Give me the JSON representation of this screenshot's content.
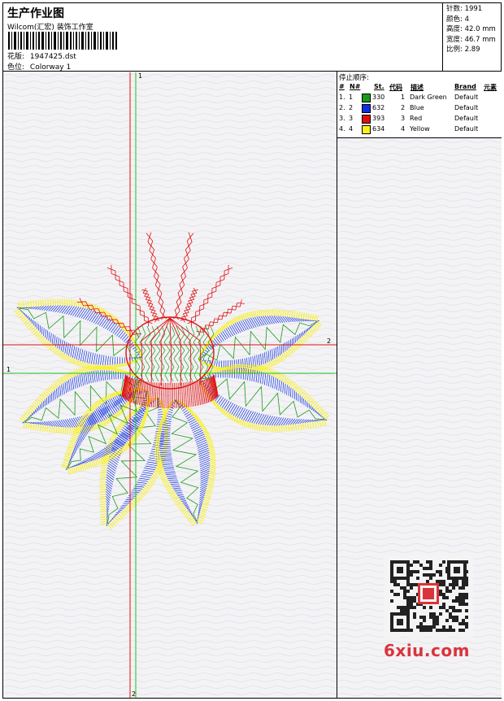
{
  "header": {
    "title": "生产作业图",
    "company": "Wilcom(汇宏) 装饰工作室",
    "design_label": "花版:",
    "design_value": "1947425.dst",
    "colorway_label": "色位:",
    "colorway_value": "Colorway 1"
  },
  "stats": [
    {
      "label": "针数:",
      "value": "1991"
    },
    {
      "label": "颜色:",
      "value": "4"
    },
    {
      "label": "高度:",
      "value": "42.0 mm"
    },
    {
      "label": "宽度:",
      "value": "46.7 mm"
    },
    {
      "label": "比例:",
      "value": "2.89"
    }
  ],
  "stop_sequence": {
    "title": "停止顺序:",
    "headers": {
      "num": "#",
      "no": "N#",
      "st": "St.",
      "code": "代码",
      "desc": "描述",
      "brand": "Brand",
      "elements": "元素"
    },
    "rows": [
      {
        "num": "1.",
        "no": "1",
        "color": "#1a9a1a",
        "st": "330",
        "code": "1",
        "desc": "Dark Green",
        "brand": "Default"
      },
      {
        "num": "2.",
        "no": "2",
        "color": "#1030e0",
        "st": "632",
        "code": "2",
        "desc": "Blue",
        "brand": "Default"
      },
      {
        "num": "3.",
        "no": "3",
        "color": "#e01010",
        "st": "393",
        "code": "3",
        "desc": "Red",
        "brand": "Default"
      },
      {
        "num": "4.",
        "no": "4",
        "color": "#f8f020",
        "st": "634",
        "code": "4",
        "desc": "Yellow",
        "brand": "Default"
      }
    ]
  },
  "axes": {
    "v1": "1",
    "v2": "2",
    "h1": "1",
    "h2": "2"
  },
  "watermark": "6xiu.com",
  "colors": {
    "green": "#1a9a1a",
    "blue": "#1030e0",
    "red": "#e01010",
    "yellow": "#f8f020"
  }
}
